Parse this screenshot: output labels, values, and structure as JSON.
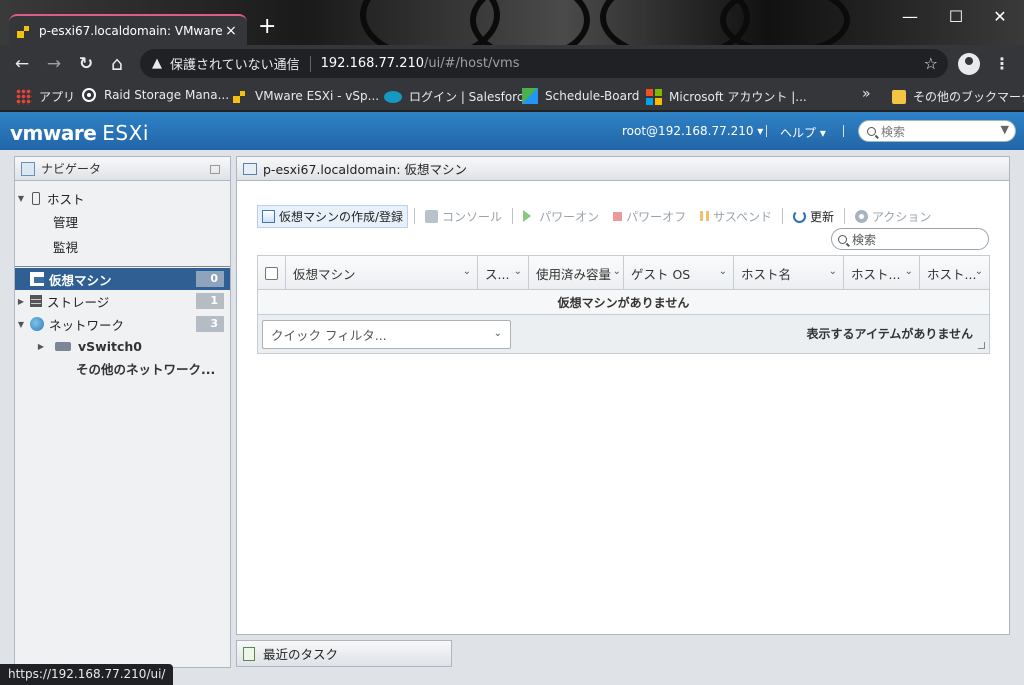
{
  "browser": {
    "tab_title": "p-esxi67.localdomain: VMware ESXi",
    "tab_close": "×",
    "new_tab": "+",
    "window_min": "—",
    "window_max": "☐",
    "window_close": "✕",
    "nav_back": "←",
    "nav_forward": "→",
    "nav_reload": "↻",
    "nav_home": "⌂",
    "security_icon": "▲",
    "security_text": "保護されていない通信",
    "url_host": "192.168.77.210",
    "url_path": "/ui/#/host/vms",
    "bookmark_star": "☆",
    "menu": "⋮",
    "bookmarks": [
      {
        "label": "アプリ",
        "icon": "apps-icon"
      },
      {
        "label": "Raid Storage Mana...",
        "icon": "raid-storage-icon"
      },
      {
        "label": "VMware ESXi - vSp...",
        "icon": "vmware-icon"
      },
      {
        "label": "ログイン | Salesforce",
        "icon": "salesforce-icon"
      },
      {
        "label": "Schedule-Board",
        "icon": "schedule-board-icon"
      },
      {
        "label": "Microsoft アカウント |...",
        "icon": "microsoft-icon"
      }
    ],
    "bookmarks_overflow": "»",
    "other_bookmarks": "その他のブックマーク",
    "status_url": "https://192.168.77.210/ui/"
  },
  "esxi": {
    "logo_brand": "vmware",
    "logo_product": "ESXi",
    "user": "root@192.168.77.210 ▾",
    "help": "ヘルプ ▾",
    "search_placeholder": "検索",
    "search_dropdown": "▼"
  },
  "navigator": {
    "title": "ナビゲータ",
    "items": [
      {
        "label": "ホスト",
        "expander": "▼",
        "icon": "host-icon"
      },
      {
        "label": "管理"
      },
      {
        "label": "監視"
      },
      {
        "label": "仮想マシン",
        "count": "0",
        "icon": "vm-icon",
        "selected": true
      },
      {
        "label": "ストレージ",
        "count": "1",
        "expander": "▶",
        "icon": "storage-icon"
      },
      {
        "label": "ネットワーク",
        "count": "3",
        "expander": "▼",
        "icon": "network-icon"
      },
      {
        "label": "vSwitch0",
        "expander": "▶",
        "icon": "vswitch-icon"
      },
      {
        "label": "その他のネットワーク..."
      }
    ]
  },
  "main": {
    "title": "p-esxi67.localdomain: 仮想マシン",
    "toolbar": {
      "create": "仮想マシンの作成/登録",
      "console": "コンソール",
      "power_on": "パワーオン",
      "power_off": "パワーオフ",
      "suspend": "サスペンド",
      "refresh": "更新",
      "actions": "アクション"
    },
    "search_placeholder": "検索",
    "columns": [
      "仮想マシン",
      "ス...",
      "使用済み容量",
      "ゲスト OS",
      "ホスト名",
      "ホスト...",
      "ホスト..."
    ],
    "column_dropdown": "⌄",
    "empty_message": "仮想マシンがありません",
    "quick_filter": "クイック フィルタ...",
    "footer_status": "表示するアイテムがありません"
  },
  "tasks": {
    "label": "最近のタスク"
  }
}
